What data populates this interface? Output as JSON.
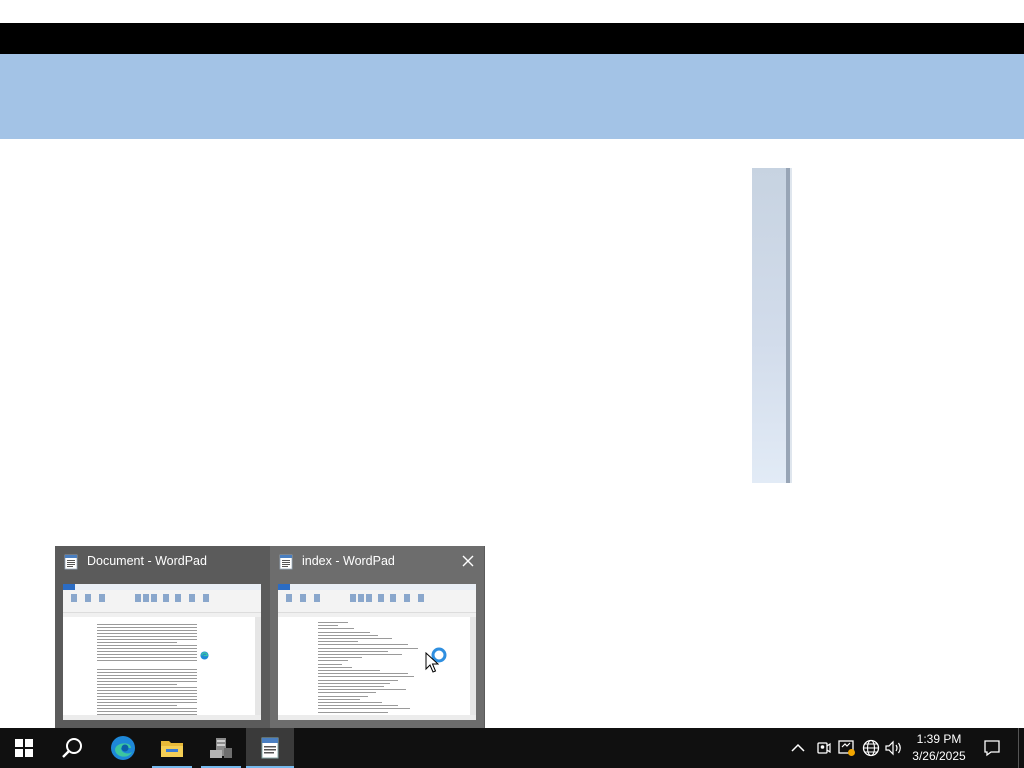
{
  "window": {
    "title": ""
  },
  "thumbnails": [
    {
      "title": "Document - WordPad",
      "app_icon": "wordpad-icon"
    },
    {
      "title": "index - WordPad",
      "app_icon": "wordpad-icon",
      "close_icon": "close-icon"
    }
  ],
  "taskbar": {
    "start_icon": "windows-start-icon",
    "search_icon": "search-icon",
    "apps": [
      {
        "name": "Microsoft Edge",
        "icon": "edge-icon"
      },
      {
        "name": "File Explorer",
        "icon": "folder-icon"
      },
      {
        "name": "Server Manager",
        "icon": "server-manager-icon"
      },
      {
        "name": "WordPad",
        "icon": "wordpad-icon"
      }
    ],
    "tray": {
      "chevron_icon": "chevron-up-icon",
      "icons": [
        "meet-now-icon",
        "action-center-shield-icon",
        "network-icon",
        "volume-icon"
      ],
      "time": "1:39 PM",
      "date": "3/26/2025",
      "notification_icon": "notification-icon"
    }
  },
  "colors": {
    "banner": "#a3c3e6",
    "taskbar": "#101010",
    "accent": "#76b9ed"
  }
}
